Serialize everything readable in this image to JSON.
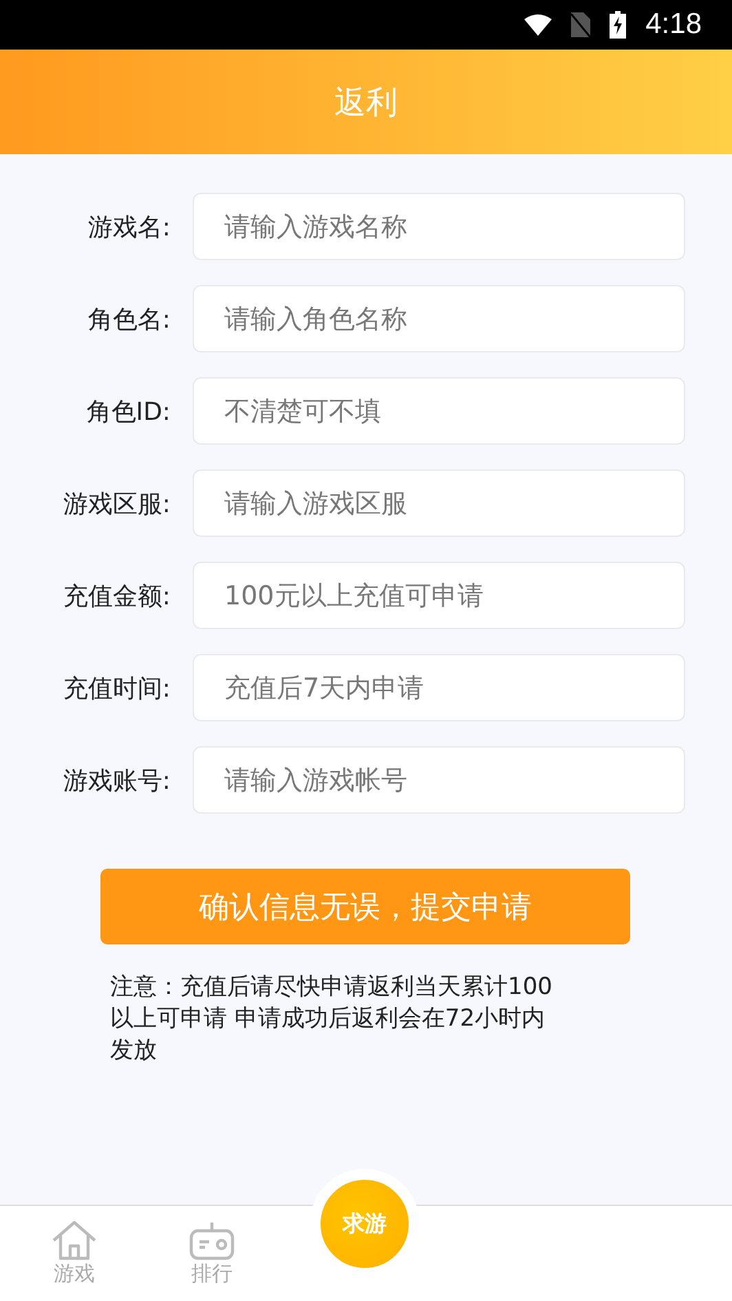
{
  "status_bar": {
    "time": "4:18"
  },
  "header": {
    "title": "返利"
  },
  "form": {
    "fields": [
      {
        "label": "游戏名:",
        "placeholder": "请输入游戏名称"
      },
      {
        "label": "角色名:",
        "placeholder": "请输入角色名称"
      },
      {
        "label": "角色ID:",
        "placeholder": "不清楚可不填"
      },
      {
        "label": "游戏区服:",
        "placeholder": "请输入游戏区服"
      },
      {
        "label": "充值金额:",
        "placeholder": "100元以上充值可申请"
      },
      {
        "label": "充值时间:",
        "placeholder": "充值后7天内申请"
      },
      {
        "label": "游戏账号:",
        "placeholder": "请输入游戏帐号"
      }
    ],
    "submit": "确认信息无误，提交申请",
    "note": "注意：充值后请尽快申请返利当天累计100以上可申请 申请成功后返利会在72小时内发放"
  },
  "bottom_nav": {
    "items": [
      {
        "kind": "home",
        "label": "游戏"
      },
      {
        "kind": "gamepad",
        "label": "排行"
      }
    ],
    "center_button": "求游"
  }
}
